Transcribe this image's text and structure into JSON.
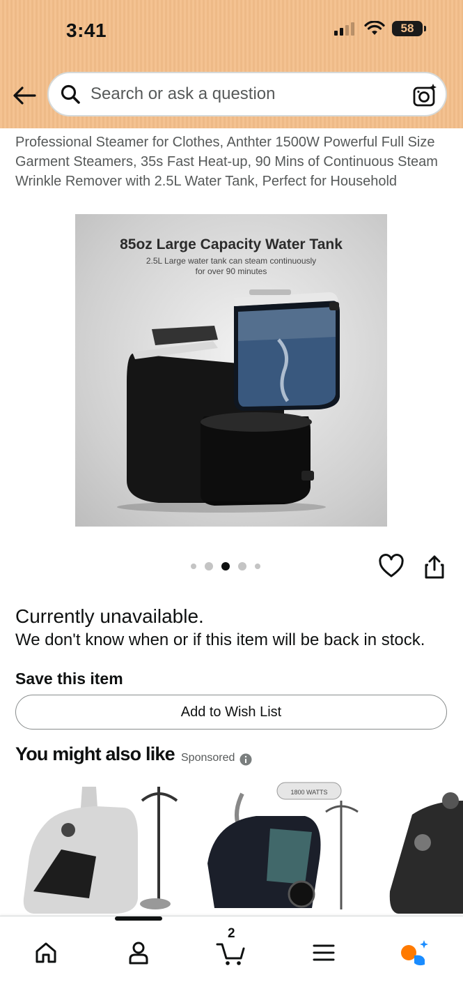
{
  "status_bar": {
    "time": "3:41",
    "battery": "58"
  },
  "search": {
    "placeholder": "Search or ask a question"
  },
  "product": {
    "title": "Professional Steamer for Clothes, Anthter 1500W Powerful Full Size Garment Steamers, 35s Fast Heat-up, 90 Mins of Continuous Steam Wrinkle Remover with 2.5L Water Tank, Perfect for Household",
    "image": {
      "headline": "85oz Large Capacity Water Tank",
      "subtext": "2.5L Large water tank can steam continuously\nfor over 90 minutes"
    },
    "image_dots": {
      "count": 5,
      "active_index": 2
    }
  },
  "availability": {
    "status": "Currently unavailable.",
    "message": "We don't know when or if this item will be back in stock."
  },
  "save": {
    "heading": "Save this item",
    "wishlist_button": "Add to Wish List"
  },
  "recommendations": {
    "heading": "You might also like",
    "sponsored_label": "Sponsored",
    "items": [
      {
        "image_text": ""
      },
      {
        "image_text": "1800 WATTS"
      },
      {
        "image_text": ""
      }
    ]
  },
  "bottom_nav": {
    "items": [
      "home-icon",
      "account-icon",
      "cart-icon",
      "menu-icon",
      "rufus-icon"
    ],
    "cart_count": "2"
  },
  "colors": {
    "header_bg": "#f3be8a",
    "text_primary": "#0f1111",
    "text_secondary": "#565959",
    "rufus_orange": "#ff7a00",
    "rufus_blue": "#1a8cff"
  }
}
